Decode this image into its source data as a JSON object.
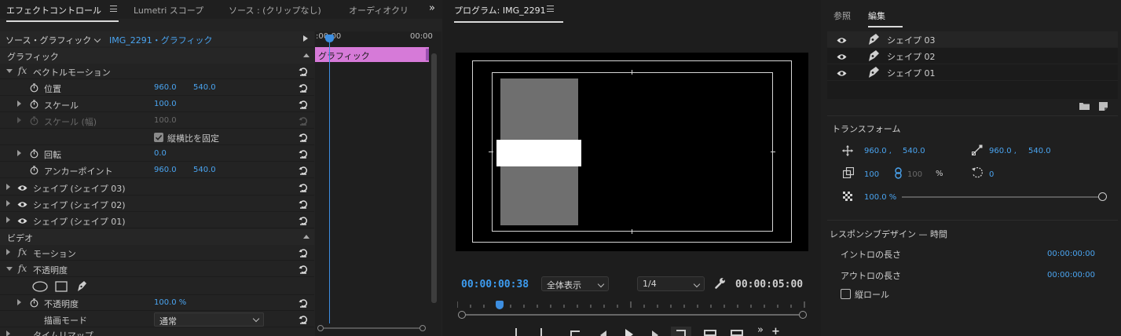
{
  "effect_controls": {
    "tabs": [
      "エフェクトコントロール",
      "Lumetri スコープ",
      "ソース : (クリップなし)",
      "オーディオクリ"
    ],
    "source_label": "ソース・グラフィック",
    "clip_label": "IMG_2291・グラフィック",
    "timeline": {
      "start": ":00:00",
      "end": "00:00",
      "clip_name": "グラフィック"
    },
    "graphic_section": "グラフィック",
    "vector_motion": "ベクトルモーション",
    "position": {
      "label": "位置",
      "x": "960.0",
      "y": "540.0"
    },
    "scale": {
      "label": "スケール",
      "value": "100.0"
    },
    "scale_width": {
      "label": "スケール (幅)",
      "value": "100.0"
    },
    "uniform_scale": "縦横比を固定",
    "rotation": {
      "label": "回転",
      "value": "0.0"
    },
    "anchor": {
      "label": "アンカーポイント",
      "x": "960.0",
      "y": "540.0"
    },
    "shapes": [
      "シェイプ (シェイプ 03)",
      "シェイプ (シェイプ 02)",
      "シェイプ (シェイプ 01)"
    ],
    "video_section": "ビデオ",
    "motion": "モーション",
    "opacity_group": "不透明度",
    "opacity": {
      "label": "不透明度",
      "value": "100.0 %"
    },
    "blend": {
      "label": "描画モード",
      "value": "通常"
    },
    "cut_off_label": "タイムリマップ"
  },
  "program": {
    "title": "プログラム: IMG_2291",
    "timecode": "00:00:00:38",
    "fit": "全体表示",
    "resolution": "1/4",
    "duration": "00:00:05:00"
  },
  "essential": {
    "tabs": [
      "参照",
      "編集"
    ],
    "layers": [
      "シェイプ 03",
      "シェイプ 02",
      "シェイプ 01"
    ],
    "transform_title": "トランスフォーム",
    "pos_x": "960.0 ,",
    "pos_y": "540.0",
    "anchor_x": "960.0 ,",
    "anchor_y": "540.0",
    "scale": "100",
    "scale2": "100",
    "percent": "%",
    "rotation": "0",
    "opacity": "100.0 %",
    "responsive_title": "レスポンシブデザイン — 時間",
    "intro_label": "イントロの長さ",
    "intro_value": "00:00:00:00",
    "outro_label": "アウトロの長さ",
    "outro_value": "00:00:00:00",
    "roll_label": "縦ロール"
  },
  "colors": {
    "accent": "#4aa4f0",
    "clip": "#d67ad8",
    "timecode": "#3d9cf0"
  }
}
